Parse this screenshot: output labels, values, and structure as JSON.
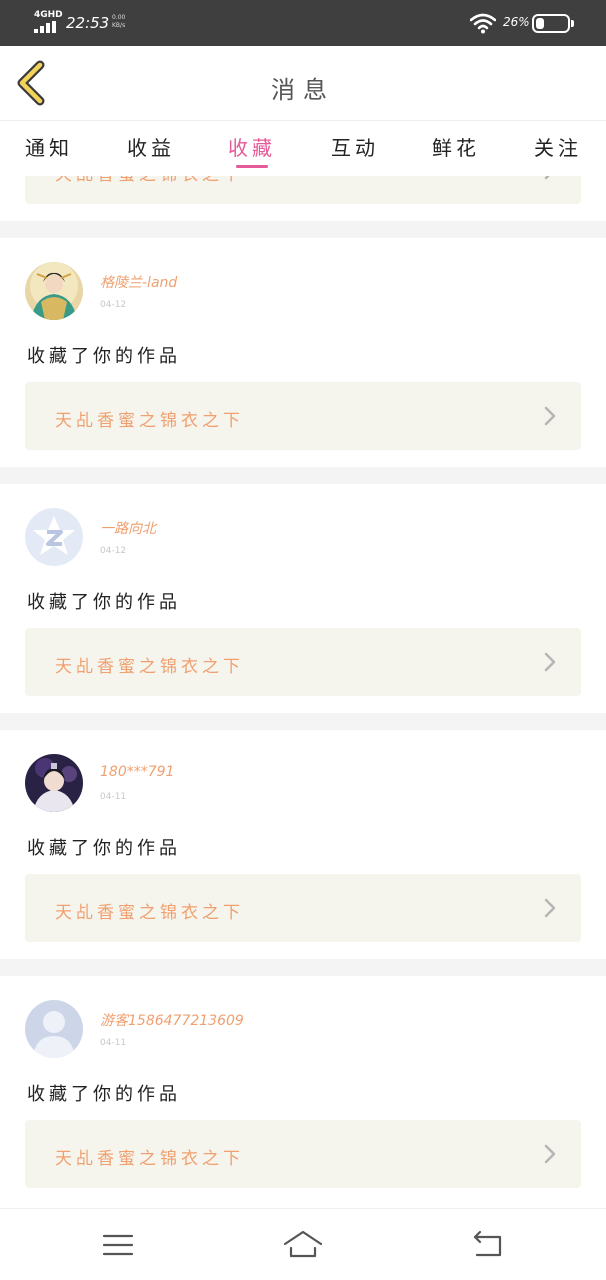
{
  "status_bar": {
    "network": "4GHD",
    "time": "22:53",
    "net_speed_value": "0.00",
    "net_speed_unit": "KB/s",
    "battery_percent": "26%",
    "battery_level": 0.26
  },
  "header": {
    "title": "消息",
    "back_icon": "chevron-left-icon"
  },
  "tabs": [
    {
      "label": "通知",
      "active": false
    },
    {
      "label": "收益",
      "active": false
    },
    {
      "label": "收藏",
      "active": true
    },
    {
      "label": "互动",
      "active": false
    },
    {
      "label": "鲜花",
      "active": false
    },
    {
      "label": "关注",
      "active": false
    }
  ],
  "cutoff_item": {
    "work_title": "天乩香蜜之锦衣之下"
  },
  "items": [
    {
      "username": "格陵兰-land",
      "date": "04-12",
      "action": "收藏了你的作品",
      "work_title": "天乩香蜜之锦衣之下",
      "avatar": "costume-character-avatar"
    },
    {
      "username": "一路向北",
      "date": "04-12",
      "action": "收藏了你的作品",
      "work_title": "天乩香蜜之锦衣之下",
      "avatar": "qzone-star-avatar"
    },
    {
      "username": "180***791",
      "date": "04-11",
      "action": "收藏了你的作品",
      "work_title": "天乩香蜜之锦衣之下",
      "avatar": "purple-character-avatar"
    },
    {
      "username": "游客1586477213609",
      "date": "04-11",
      "action": "收藏了你的作品",
      "work_title": "天乩香蜜之锦衣之下",
      "avatar": "default-person-avatar"
    }
  ],
  "navbar": {
    "menu_icon": "menu-icon",
    "home_icon": "home-icon",
    "back_icon": "return-icon"
  },
  "colors": {
    "accent": "#e55a98",
    "username": "#f0a070",
    "work_box_bg": "#f5f5ed",
    "status_bar_bg": "#3f3f3f"
  }
}
